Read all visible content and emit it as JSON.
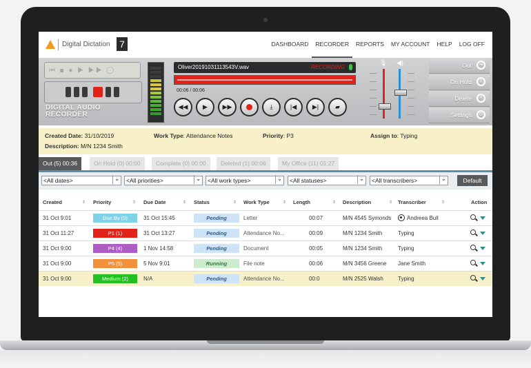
{
  "app": {
    "name": "Digital Dictation",
    "version_badge": "7"
  },
  "nav": [
    "DASHBOARD",
    "RECORDER",
    "REPORTS",
    "MY ACCOUNT",
    "HELP",
    "LOG OFF"
  ],
  "nav_active": "RECORDER",
  "recorder": {
    "label_line1": "DIGITAL AUDIO",
    "label_line2": "RECORDER",
    "filename": "Oliver20191031113543V.wav",
    "status": "RECORDING",
    "time": "00:06 / 00:06",
    "buttons": [
      "rewind-icon",
      "play-icon",
      "fast-forward-icon",
      "record-icon",
      "insert-icon",
      "skip-start-icon",
      "skip-end-icon",
      "open-folder-icon"
    ],
    "side_buttons": [
      {
        "label": "Out",
        "icon": "arrow-right-icon"
      },
      {
        "label": "On Hold",
        "icon": "hold-icon"
      },
      {
        "label": "Delete",
        "icon": "delete-icon"
      },
      {
        "label": "Settings",
        "icon": "settings-icon"
      }
    ]
  },
  "details": {
    "created_date_label": "Created Date:",
    "created_date": "31/10/2019",
    "work_type_label": "Work Type",
    "work_type": ": Attendance Notes",
    "priority_label": "Priority",
    "priority": ": P3",
    "assign_label": "Assign to",
    "assign": ": Typing",
    "description_label": "Description:",
    "description": "M/N 1234 Smith"
  },
  "tabs": [
    "Out (5) 00:36",
    "On Hold (0) 00:00",
    "Complete (0) 00:00",
    "Deleted (1) 00:06",
    "My Office (11) 01:27"
  ],
  "filters": [
    "<All dates>",
    "<All priorities>",
    "<All work types>",
    "<All statuses>",
    "<All transcribers>"
  ],
  "default_button": "Default",
  "columns": [
    "Created",
    "Priority",
    "Due Date",
    "Status",
    "Work Type",
    "Length",
    "Description",
    "Transcriber",
    "Action"
  ],
  "rows": [
    {
      "created": "31 Oct 9:01",
      "priority": "Due By (0)",
      "priority_color": "#7ed3e8",
      "due": "31 Oct 15:45",
      "status": "Pending",
      "work_type": "Letter",
      "length": "00:07",
      "description": "M/N 4545 Symonds",
      "transcriber": "Andreea Bull"
    },
    {
      "created": "31 Oct 11:27",
      "priority": "P1 (1)",
      "priority_color": "#e2231a",
      "due": "31 Oct 13:27",
      "status": "Pending",
      "work_type": "Attendance No...",
      "length": "00:09",
      "description": "M/N 1234 Smith",
      "transcriber": "Typing"
    },
    {
      "created": "31 Oct 9:00",
      "priority": "P4 (4)",
      "priority_color": "#b05cc6",
      "due": "1 Nov 14:58",
      "status": "Pending",
      "work_type": "Document",
      "length": "00:05",
      "description": "M/N 1234 Smith",
      "transcriber": "Typing"
    },
    {
      "created": "31 Oct 9:00",
      "priority": "P5 (5)",
      "priority_color": "#f3913a",
      "due": "5 Nov 9:01",
      "status": "Running",
      "work_type": "File note",
      "length": "00:06",
      "description": "M/N 3456 Greene",
      "transcriber": "Jane Smith"
    },
    {
      "created": "31 Oct 9:00",
      "priority": "Medium (2)",
      "priority_color": "#22c11f",
      "due": "N/A",
      "status": "Pending",
      "work_type": "Attendance No...",
      "length": "00:0",
      "description": "M/N 2525 Walsh",
      "transcriber": "Typing"
    }
  ]
}
